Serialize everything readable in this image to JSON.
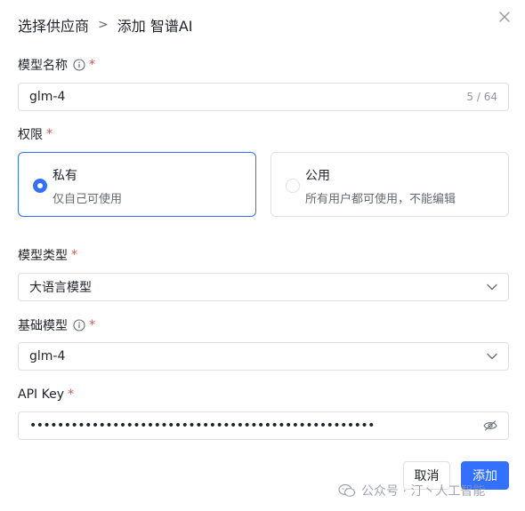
{
  "header": {
    "breadcrumb_parent": "选择供应商",
    "separator": ">",
    "title": "添加 智谱AI"
  },
  "model_name": {
    "label": "模型名称",
    "required_mark": "*",
    "value": "glm-4",
    "count": "5 / 64"
  },
  "permission": {
    "label": "权限",
    "required_mark": "*",
    "options": [
      {
        "title": "私有",
        "desc": "仅自己可使用",
        "selected": true
      },
      {
        "title": "公用",
        "desc": "所有用户都可使用，不能编辑",
        "selected": false
      }
    ]
  },
  "model_type": {
    "label": "模型类型",
    "required_mark": "*",
    "value": "大语言模型"
  },
  "base_model": {
    "label": "基础模型",
    "required_mark": "*",
    "value": "glm-4"
  },
  "api_key": {
    "label": "API Key",
    "required_mark": "*",
    "value": "••••••••••••••••••••••••••••••••••••••••••••••••••"
  },
  "buttons": {
    "cancel": "取消",
    "add": "添加"
  },
  "watermark": {
    "text": "公众号 · 汀丶人工智能"
  },
  "colors": {
    "primary": "#3370ff",
    "required": "#f54a45",
    "border": "#dee0e3"
  }
}
